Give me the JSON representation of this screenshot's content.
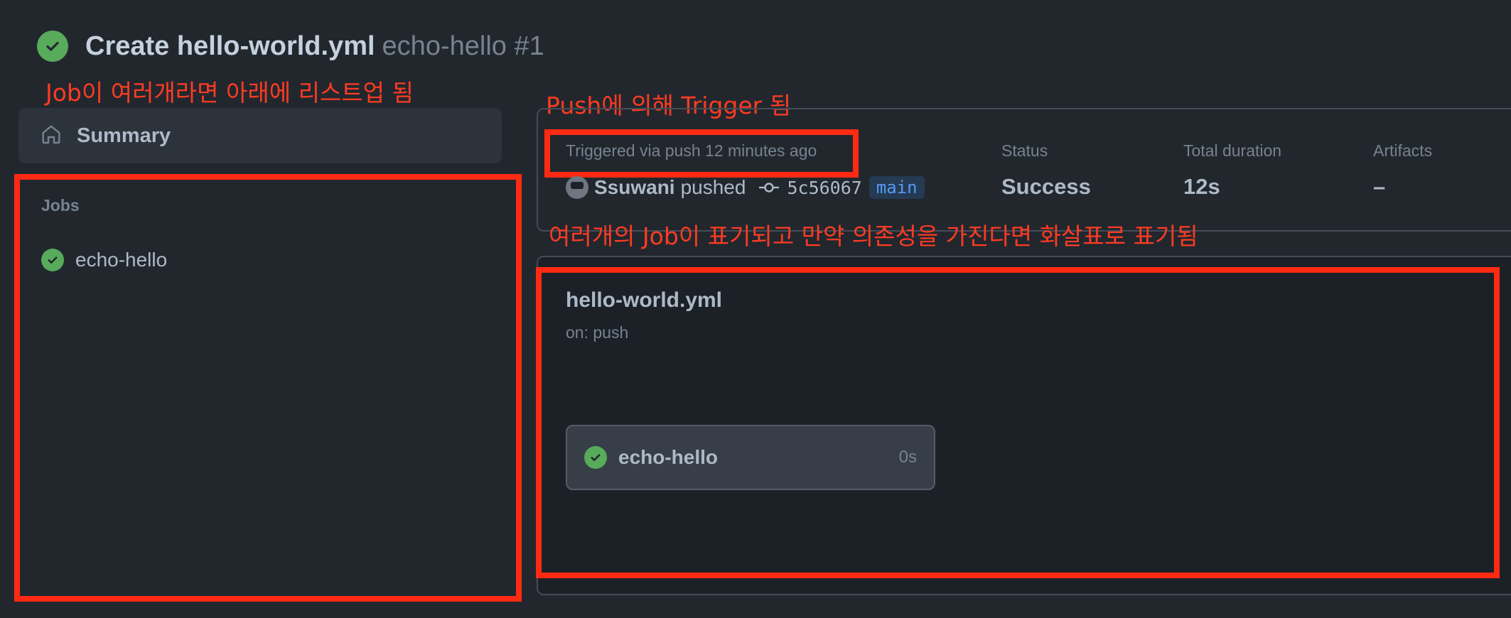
{
  "header": {
    "title": "Create hello-world.yml",
    "subtitle": "echo-hello #1",
    "status_icon": "check-circle-icon",
    "status_color": "#57ab5a"
  },
  "annotations": {
    "jobs_note": "Job이 여러개라면 아래에 리스트업 됨",
    "trigger_note": "Push에 의해 Trigger 됨",
    "graph_note": "여러개의 Job이 표기되고 만약 의존성을 가진다면 화살표로 표기됨",
    "color": "#ff2a12"
  },
  "sidebar": {
    "summary_label": "Summary",
    "jobs_heading": "Jobs",
    "jobs": [
      {
        "label": "echo-hello",
        "status": "success"
      }
    ]
  },
  "run_info": {
    "trigger": "Triggered via push 12 minutes ago",
    "user": "Ssuwani",
    "action": "pushed",
    "commit": "5c56067",
    "branch": "main",
    "status_label": "Status",
    "status_value": "Success",
    "duration_label": "Total duration",
    "duration_value": "12s",
    "artifacts_label": "Artifacts",
    "artifacts_value": "–"
  },
  "workflow": {
    "name": "hello-world.yml",
    "on": "on: push",
    "job": {
      "label": "echo-hello",
      "duration": "0s"
    }
  }
}
